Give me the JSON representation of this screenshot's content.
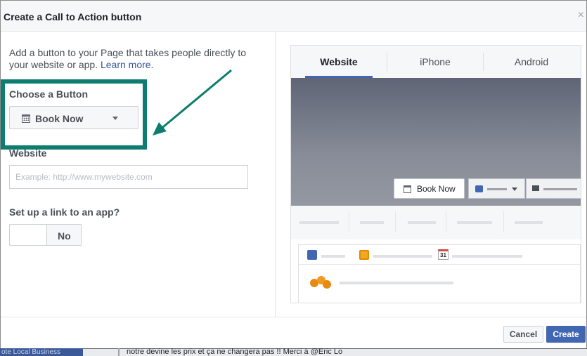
{
  "dialog": {
    "title": "Create a Call to Action button",
    "close_symbol": "×"
  },
  "intro": {
    "text": "Add a button to your Page that takes people directly to your website or app.",
    "link_label": "Learn more."
  },
  "choose_button": {
    "label": "Choose a Button",
    "selected": "Book Now",
    "icon": "calendar-icon"
  },
  "website": {
    "label": "Website",
    "value": "",
    "placeholder": "Example: http://www.mywebsite.com"
  },
  "app_link": {
    "label": "Set up a link to an app?",
    "toggle_value": "No"
  },
  "preview": {
    "tabs": [
      {
        "label": "Website",
        "active": true
      },
      {
        "label": "iPhone",
        "active": false
      },
      {
        "label": "Android",
        "active": false
      }
    ],
    "cta_button_label": "Book Now",
    "calendar_day": "31"
  },
  "footer": {
    "cancel_label": "Cancel",
    "create_label": "Create"
  },
  "background": {
    "left_tab_text": "ote Local Business",
    "snippet_text": "notre devine les prix et ça ne changera pas !! Merci à @Eric Lo"
  },
  "colors": {
    "highlight": "#0d7d6f",
    "accent": "#4267b2",
    "link": "#365899"
  }
}
